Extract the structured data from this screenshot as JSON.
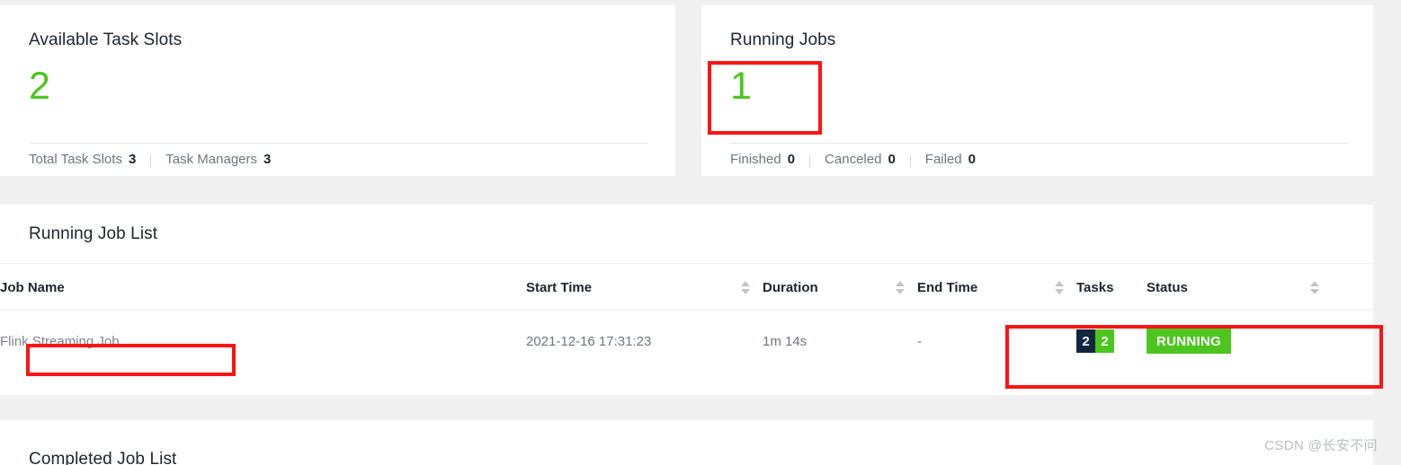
{
  "cards": [
    {
      "title": "Available Task Slots",
      "value": "2",
      "value_color": "#4cc61e",
      "stats": [
        {
          "label": "Total Task Slots",
          "value": "3"
        },
        {
          "label": "Task Managers",
          "value": "3"
        }
      ]
    },
    {
      "title": "Running Jobs",
      "value": "1",
      "value_color": "#4cc61e",
      "stats": [
        {
          "label": "Finished",
          "value": "0"
        },
        {
          "label": "Canceled",
          "value": "0"
        },
        {
          "label": "Failed",
          "value": "0"
        }
      ]
    }
  ],
  "running_job_list": {
    "title": "Running Job List",
    "columns": [
      {
        "label": "Job Name",
        "sortable": false
      },
      {
        "label": "Start Time",
        "sortable": true
      },
      {
        "label": "Duration",
        "sortable": true
      },
      {
        "label": "End Time",
        "sortable": true
      },
      {
        "label": "Tasks",
        "sortable": false
      },
      {
        "label": "Status",
        "sortable": true
      }
    ],
    "rows": [
      {
        "job_name": "Flink Streaming Job",
        "start_time": "2021-12-16 17:31:23",
        "duration": "1m 14s",
        "end_time": "-",
        "tasks": [
          {
            "count": "2",
            "color": "#11263f"
          },
          {
            "count": "2",
            "color": "#4cc61e"
          }
        ],
        "status": "RUNNING",
        "status_color": "#4cc61e"
      }
    ]
  },
  "completed_job_list": {
    "title": "Completed Job List"
  },
  "annotations": {
    "color": "#fc1414",
    "boxes": [
      "running-jobs-value",
      "job-name-cell",
      "tasks-and-status-cells"
    ]
  },
  "watermark": {
    "text": "CSDN @长安不问"
  }
}
